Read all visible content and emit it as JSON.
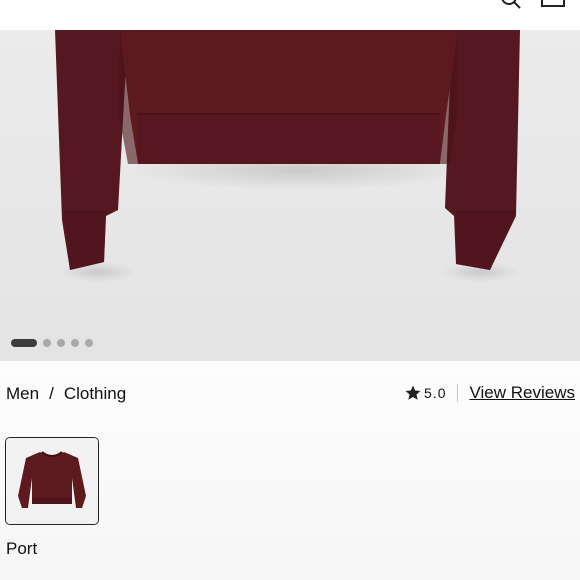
{
  "product": {
    "image_alt": "Port crewneck sweatshirt",
    "carousel": {
      "total": 5,
      "active": 1
    }
  },
  "breadcrumb": {
    "items": [
      "Men",
      "Clothing"
    ],
    "separator": "/"
  },
  "rating": {
    "score": "5.0",
    "reviews_link": "View Reviews"
  },
  "color_swatches": [
    {
      "name": "Port",
      "color": "#5c1a1f",
      "selected": true
    }
  ],
  "colors": {
    "garment": "#5c1a1f",
    "garment_shadow": "#4a1318",
    "dot_active": "#3d3d3d",
    "dot_inactive": "#a9a9a9"
  }
}
